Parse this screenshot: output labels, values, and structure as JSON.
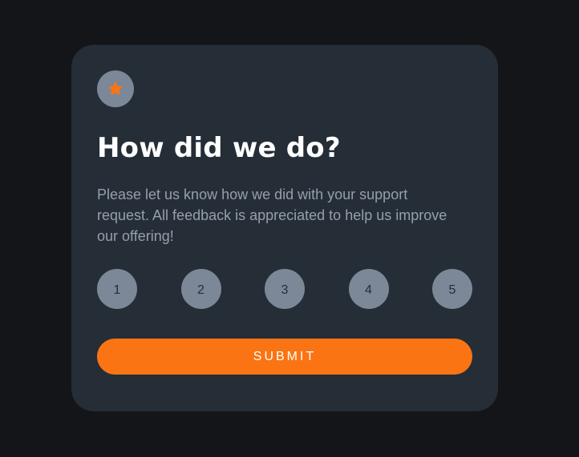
{
  "card": {
    "icon": "star-icon",
    "title": "How did we do?",
    "description": "Please let us know how we did with your support request. All feedback is appreciated to help us improve our offering!",
    "ratings": [
      "1",
      "2",
      "3",
      "4",
      "5"
    ],
    "submit_label": "SUBMIT"
  },
  "colors": {
    "background": "#131518",
    "card": "#252d37",
    "accent": "#fb7413",
    "rating_circle": "#7c8798",
    "text_muted": "#969fad"
  }
}
